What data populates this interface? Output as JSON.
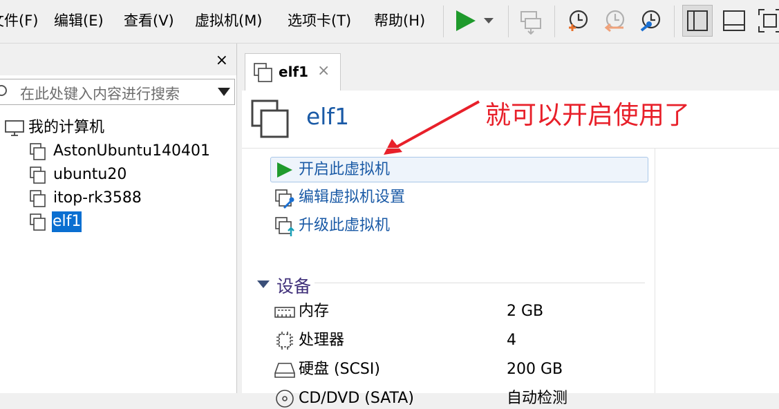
{
  "menu": [
    "文件(F)",
    "编辑(E)",
    "查看(V)",
    "虚拟机(M)",
    "选项卡(T)",
    "帮助(H)"
  ],
  "library": {
    "close": "×",
    "search_placeholder": "在此处键入内容进行搜索",
    "root": "我的计算机",
    "vms": [
      "AstonUbuntu140401",
      "ubuntu20",
      "itop-rk3588",
      "elf1"
    ],
    "selected": "elf1"
  },
  "tab": {
    "label": "elf1",
    "close": "×"
  },
  "vm": {
    "title": "elf1",
    "annotation": "就可以开启使用了",
    "actions": [
      "开启此虚拟机",
      "编辑虚拟机设置",
      "升级此虚拟机"
    ]
  },
  "devices": {
    "section_title": "设备",
    "rows": [
      {
        "name": "内存",
        "value": "2 GB",
        "icon": "memory-icon"
      },
      {
        "name": "处理器",
        "value": "4",
        "icon": "cpu-icon"
      },
      {
        "name": "硬盘 (SCSI)",
        "value": "200 GB",
        "icon": "disk-icon"
      },
      {
        "name": "CD/DVD (SATA)",
        "value": "自动检测",
        "icon": "cdrom-icon"
      }
    ]
  },
  "colors": {
    "accent": "#1a5aa6",
    "play": "#1f9a2c",
    "annotation": "#e8202a",
    "selection": "#0a6fd1"
  }
}
